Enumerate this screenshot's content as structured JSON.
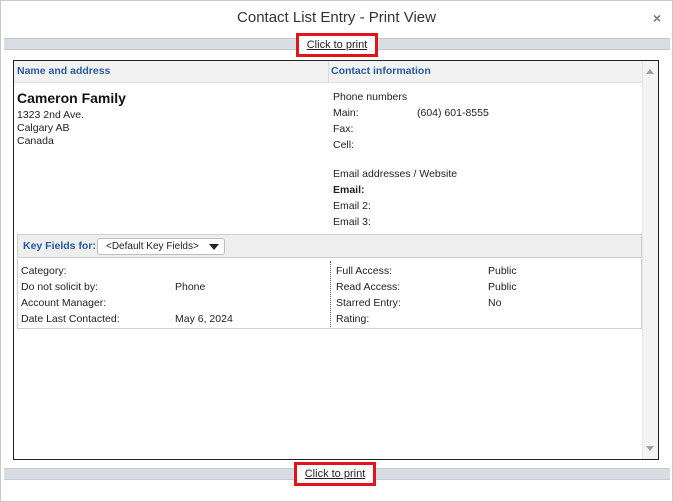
{
  "window": {
    "title": "Contact List Entry - Print View",
    "close_glyph": "×"
  },
  "print_link": {
    "label": "Click to print"
  },
  "headers": {
    "left": "Name and address",
    "right": "Contact information"
  },
  "contact": {
    "name": "Cameron Family",
    "address": [
      "1323 2nd Ave.",
      "Calgary AB",
      "Canada"
    ]
  },
  "phone": {
    "section": "Phone numbers",
    "main_label": "Main:",
    "main_value": "(604) 601-8555",
    "fax_label": "Fax:",
    "cell_label": "Cell:"
  },
  "email": {
    "section": "Email addresses / Website",
    "email_label": "Email:",
    "email2_label": "Email 2:",
    "email3_label": "Email 3:"
  },
  "key_fields": {
    "label": "Key Fields for:",
    "selected": "<Default Key Fields>"
  },
  "fields_left": [
    {
      "label": "Category:",
      "value": ""
    },
    {
      "label": "Do not solicit by:",
      "value": "Phone"
    },
    {
      "label": "Account Manager:",
      "value": ""
    },
    {
      "label": "Date Last Contacted:",
      "value": "May 6, 2024"
    }
  ],
  "fields_right": [
    {
      "label": "Full Access:",
      "value": "Public"
    },
    {
      "label": "Read Access:",
      "value": "Public"
    },
    {
      "label": "Starred Entry:",
      "value": "No"
    },
    {
      "label": "Rating:",
      "value": ""
    }
  ]
}
